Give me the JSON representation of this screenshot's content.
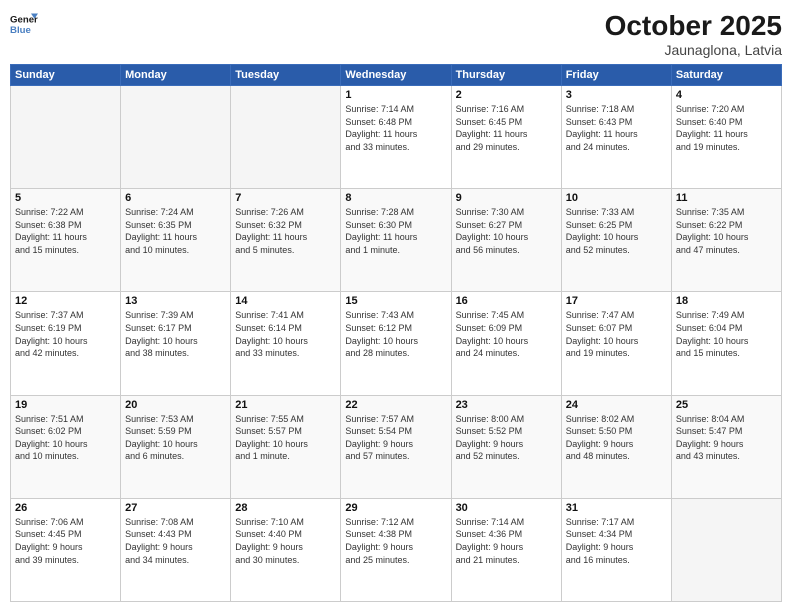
{
  "header": {
    "logo_line1": "General",
    "logo_line2": "Blue",
    "month": "October 2025",
    "location": "Jaunaglona, Latvia"
  },
  "weekdays": [
    "Sunday",
    "Monday",
    "Tuesday",
    "Wednesday",
    "Thursday",
    "Friday",
    "Saturday"
  ],
  "weeks": [
    [
      {
        "day": "",
        "info": ""
      },
      {
        "day": "",
        "info": ""
      },
      {
        "day": "",
        "info": ""
      },
      {
        "day": "1",
        "info": "Sunrise: 7:14 AM\nSunset: 6:48 PM\nDaylight: 11 hours\nand 33 minutes."
      },
      {
        "day": "2",
        "info": "Sunrise: 7:16 AM\nSunset: 6:45 PM\nDaylight: 11 hours\nand 29 minutes."
      },
      {
        "day": "3",
        "info": "Sunrise: 7:18 AM\nSunset: 6:43 PM\nDaylight: 11 hours\nand 24 minutes."
      },
      {
        "day": "4",
        "info": "Sunrise: 7:20 AM\nSunset: 6:40 PM\nDaylight: 11 hours\nand 19 minutes."
      }
    ],
    [
      {
        "day": "5",
        "info": "Sunrise: 7:22 AM\nSunset: 6:38 PM\nDaylight: 11 hours\nand 15 minutes."
      },
      {
        "day": "6",
        "info": "Sunrise: 7:24 AM\nSunset: 6:35 PM\nDaylight: 11 hours\nand 10 minutes."
      },
      {
        "day": "7",
        "info": "Sunrise: 7:26 AM\nSunset: 6:32 PM\nDaylight: 11 hours\nand 5 minutes."
      },
      {
        "day": "8",
        "info": "Sunrise: 7:28 AM\nSunset: 6:30 PM\nDaylight: 11 hours\nand 1 minute."
      },
      {
        "day": "9",
        "info": "Sunrise: 7:30 AM\nSunset: 6:27 PM\nDaylight: 10 hours\nand 56 minutes."
      },
      {
        "day": "10",
        "info": "Sunrise: 7:33 AM\nSunset: 6:25 PM\nDaylight: 10 hours\nand 52 minutes."
      },
      {
        "day": "11",
        "info": "Sunrise: 7:35 AM\nSunset: 6:22 PM\nDaylight: 10 hours\nand 47 minutes."
      }
    ],
    [
      {
        "day": "12",
        "info": "Sunrise: 7:37 AM\nSunset: 6:19 PM\nDaylight: 10 hours\nand 42 minutes."
      },
      {
        "day": "13",
        "info": "Sunrise: 7:39 AM\nSunset: 6:17 PM\nDaylight: 10 hours\nand 38 minutes."
      },
      {
        "day": "14",
        "info": "Sunrise: 7:41 AM\nSunset: 6:14 PM\nDaylight: 10 hours\nand 33 minutes."
      },
      {
        "day": "15",
        "info": "Sunrise: 7:43 AM\nSunset: 6:12 PM\nDaylight: 10 hours\nand 28 minutes."
      },
      {
        "day": "16",
        "info": "Sunrise: 7:45 AM\nSunset: 6:09 PM\nDaylight: 10 hours\nand 24 minutes."
      },
      {
        "day": "17",
        "info": "Sunrise: 7:47 AM\nSunset: 6:07 PM\nDaylight: 10 hours\nand 19 minutes."
      },
      {
        "day": "18",
        "info": "Sunrise: 7:49 AM\nSunset: 6:04 PM\nDaylight: 10 hours\nand 15 minutes."
      }
    ],
    [
      {
        "day": "19",
        "info": "Sunrise: 7:51 AM\nSunset: 6:02 PM\nDaylight: 10 hours\nand 10 minutes."
      },
      {
        "day": "20",
        "info": "Sunrise: 7:53 AM\nSunset: 5:59 PM\nDaylight: 10 hours\nand 6 minutes."
      },
      {
        "day": "21",
        "info": "Sunrise: 7:55 AM\nSunset: 5:57 PM\nDaylight: 10 hours\nand 1 minute."
      },
      {
        "day": "22",
        "info": "Sunrise: 7:57 AM\nSunset: 5:54 PM\nDaylight: 9 hours\nand 57 minutes."
      },
      {
        "day": "23",
        "info": "Sunrise: 8:00 AM\nSunset: 5:52 PM\nDaylight: 9 hours\nand 52 minutes."
      },
      {
        "day": "24",
        "info": "Sunrise: 8:02 AM\nSunset: 5:50 PM\nDaylight: 9 hours\nand 48 minutes."
      },
      {
        "day": "25",
        "info": "Sunrise: 8:04 AM\nSunset: 5:47 PM\nDaylight: 9 hours\nand 43 minutes."
      }
    ],
    [
      {
        "day": "26",
        "info": "Sunrise: 7:06 AM\nSunset: 4:45 PM\nDaylight: 9 hours\nand 39 minutes."
      },
      {
        "day": "27",
        "info": "Sunrise: 7:08 AM\nSunset: 4:43 PM\nDaylight: 9 hours\nand 34 minutes."
      },
      {
        "day": "28",
        "info": "Sunrise: 7:10 AM\nSunset: 4:40 PM\nDaylight: 9 hours\nand 30 minutes."
      },
      {
        "day": "29",
        "info": "Sunrise: 7:12 AM\nSunset: 4:38 PM\nDaylight: 9 hours\nand 25 minutes."
      },
      {
        "day": "30",
        "info": "Sunrise: 7:14 AM\nSunset: 4:36 PM\nDaylight: 9 hours\nand 21 minutes."
      },
      {
        "day": "31",
        "info": "Sunrise: 7:17 AM\nSunset: 4:34 PM\nDaylight: 9 hours\nand 16 minutes."
      },
      {
        "day": "",
        "info": ""
      }
    ]
  ]
}
